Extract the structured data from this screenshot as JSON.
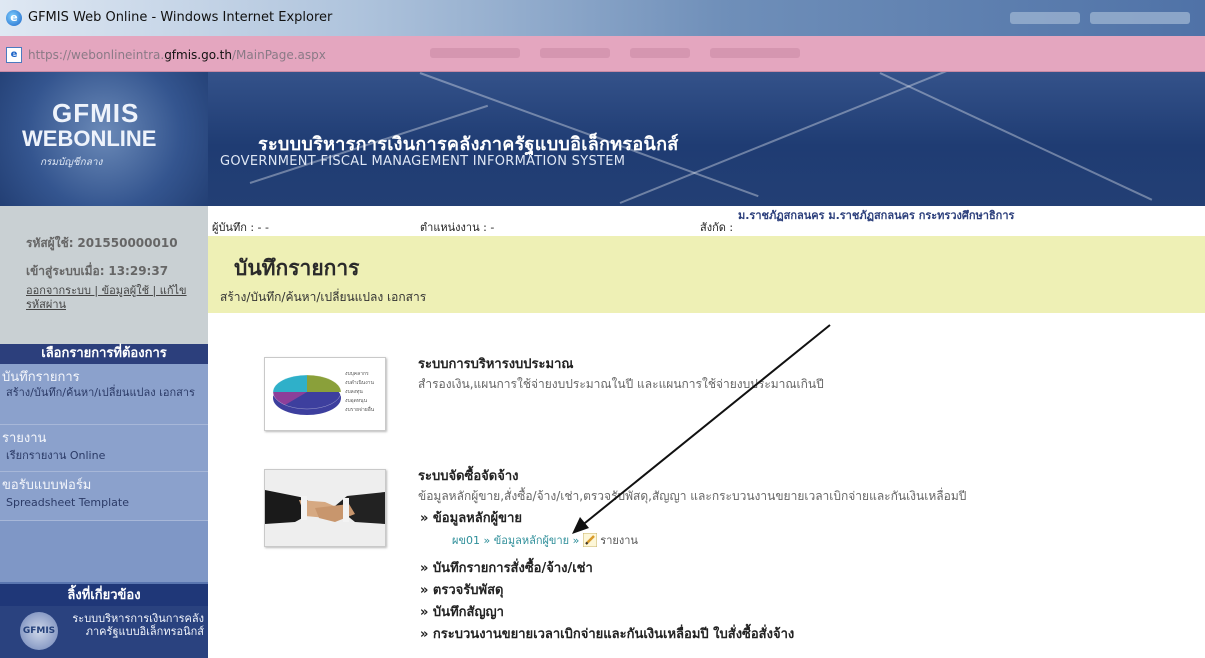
{
  "window": {
    "title": "GFMIS Web Online - Windows Internet Explorer"
  },
  "address": {
    "url_prefix": "https://webonlineintra.",
    "url_domain": "gfmis.go.th",
    "url_suffix": "/MainPage.aspx"
  },
  "banner": {
    "logo_line1": "GFMIS",
    "logo_line2": "WEBONLINE",
    "logo_line3": "กรมบัญชีกลาง",
    "title_th": "ระบบบริหารการเงินการคลังภาครัฐแบบอิเล็กทรอนิกส์",
    "title_en": "GOVERNMENT FISCAL MANAGEMENT INFORMATION SYSTEM"
  },
  "user": {
    "id_label": "รหัสผู้ใช้:",
    "id_value": "201550000010",
    "login_label": "เข้าสู่ระบบเมื่อ:",
    "login_time": "13:29:37",
    "links": "ออกจากระบบ | ข้อมูลผู้ใช้ | แก้ไขรหัสผ่าน"
  },
  "info": {
    "recorder": "ผู้บันทึก : - -",
    "position": "ตำแหน่งงาน : -",
    "affiliation_label": "สังกัด :",
    "affiliation_value": "ม.ราชภัฏสกลนคร ม.ราชภัฏสกลนคร กระทรวงศึกษาธิการ"
  },
  "sidebar": {
    "select_title": "เลือกรายการที่ต้องการ",
    "items": [
      {
        "label": "บันทึกรายการ",
        "sub": "สร้าง/บันทึก/ค้นหา/เปลี่ยนแปลง เอกสาร"
      },
      {
        "label": "รายงาน",
        "sub": "เรียกรายงาน Online"
      },
      {
        "label": "ขอรับแบบฟอร์ม",
        "sub": "Spreadsheet Template"
      }
    ],
    "related_title": "ลิ้งที่เกี่ยวข้อง",
    "related_logo_label": "GFMIS",
    "related_link": "ระบบบริหารการเงินการคลังภาครัฐแบบอิเล็กทรอนิกส์"
  },
  "page": {
    "title": "บันทึกรายการ",
    "subtitle": "สร้าง/บันทึก/ค้นหา/เปลี่ยนแปลง เอกสาร"
  },
  "sections": {
    "budget": {
      "title": "ระบบการบริหารงบประมาณ",
      "desc": "สำรองเงิน,แผนการใช้จ่ายงบประมาณในปี และแผนการใช้จ่ายงบประมาณเกินปี",
      "legend": [
        "งบบุคลากร",
        "งบดำเนินงาน",
        "งบลงทุน",
        "งบอุดหนุน",
        "งบรายจ่ายอื่น"
      ]
    },
    "procurement": {
      "title": "ระบบจัดซื้อจัดจ้าง",
      "desc": "ข้อมูลหลักผู้ขาย,สั่งซื้อ/จ้าง/เช่า,ตรวจรับพัสดุ,สัญญา และกระบวนงานขยายเวลาเบิกจ่ายและกันเงินเหลื่อมปี",
      "vendor_master": "» ข้อมูลหลักผู้ขาย",
      "sub_code": "ผข01",
      "sub_sep1": "»",
      "sub_vendor": "ข้อมูลหลักผู้ขาย",
      "sub_sep2": "»",
      "sub_report": "รายงาน",
      "links": [
        "» บันทึกรายการสั่งซื้อ/จ้าง/เช่า",
        "» ตรวจรับพัสดุ",
        "» บันทึกสัญญา",
        "» กระบวนงานขยายเวลาเบิกจ่ายและกันเงินเหลื่อมปี ใบสั่งซื้อสั่งจ้าง"
      ]
    }
  },
  "colors": {
    "banner": "#1f3c73",
    "header_bg": "#eef0b5",
    "sidebar": "#8ba1cc",
    "address_bg": "#e4a6bf"
  }
}
